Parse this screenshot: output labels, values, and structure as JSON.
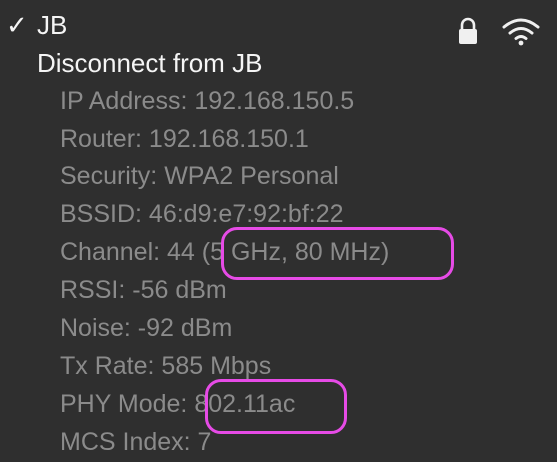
{
  "network": {
    "checkmark": "✓",
    "name": "JB",
    "lock_icon": "lock-icon",
    "wifi_icon": "wifi-icon"
  },
  "disconnect_label": "Disconnect from JB",
  "details": [
    "IP Address: 192.168.150.5",
    "Router: 192.168.150.1",
    "Security: WPA2 Personal",
    "BSSID: 46:d9:e7:92:bf:22",
    "Channel: 44 (5 GHz, 80 MHz)",
    "RSSI: -56 dBm",
    "Noise: -92 dBm",
    "Tx Rate: 585 Mbps",
    "PHY Mode: 802.11ac",
    "MCS Index: 7"
  ],
  "highlight_color": "#e64be6"
}
